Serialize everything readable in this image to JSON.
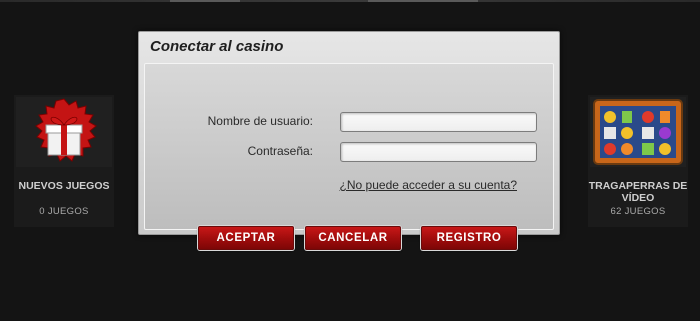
{
  "dialog": {
    "title": "Conectar al casino",
    "username_label": "Nombre de usuario:",
    "username_value": "",
    "password_label": "Contraseña:",
    "password_value": "",
    "forgot_link": "¿No puede acceder a su cuenta?",
    "buttons": {
      "accept": "ACEPTAR",
      "cancel": "CANCELAR",
      "register": "REGISTRO"
    }
  },
  "categories": [
    {
      "name": "NUEVOS JUEGOS",
      "count": "0  JUEGOS",
      "icon": "gift-box-icon"
    },
    {
      "name": "TRAGAPERRAS DE VÍDEO",
      "count": "62  JUEGOS",
      "icon": "slot-machine-icon"
    }
  ],
  "colors": {
    "background": "#141414",
    "button_red": "#b01212",
    "dialog_gray": "#d4d4d4"
  }
}
